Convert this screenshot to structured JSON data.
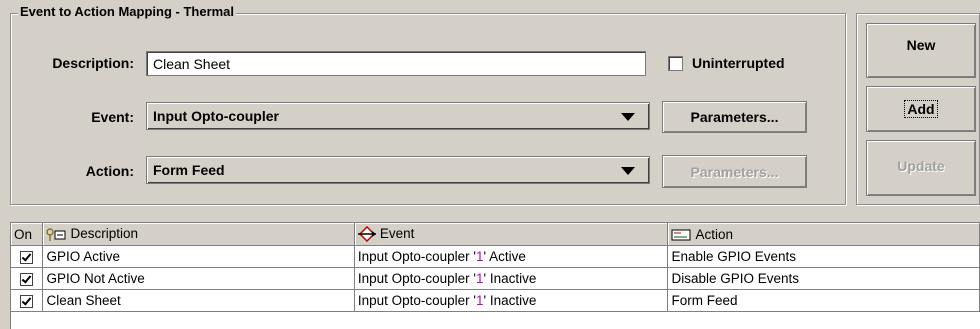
{
  "group": {
    "title": "Event to Action Mapping - Thermal"
  },
  "form": {
    "description_label": "Description:",
    "description_value": "Clean Sheet",
    "uninterrupted_label": "Uninterrupted",
    "event_label": "Event:",
    "event_value": "Input Opto-coupler",
    "event_params_label": "Parameters...",
    "action_label": "Action:",
    "action_value": "Form Feed",
    "action_params_label": "Parameters..."
  },
  "buttons": {
    "new": "New",
    "add": "Add",
    "update": "Update"
  },
  "table": {
    "headers": {
      "on": "On",
      "description": "Description",
      "event": "Event",
      "action": "Action"
    },
    "rows": [
      {
        "on": true,
        "description": "GPIO Active",
        "event_prefix": "Input Opto-coupler '",
        "event_num": "1",
        "event_suffix": "' Active",
        "action": "Enable GPIO Events"
      },
      {
        "on": true,
        "description": "GPIO Not Active",
        "event_prefix": "Input Opto-coupler '",
        "event_num": "1",
        "event_suffix": "' Inactive",
        "action": "Disable GPIO Events"
      },
      {
        "on": true,
        "description": "Clean Sheet",
        "event_prefix": "Input Opto-coupler '",
        "event_num": "1",
        "event_suffix": "' Inactive",
        "action": "Form Feed"
      }
    ]
  },
  "colors": {
    "background": "#d4d0c8",
    "highlight_number": "#c000c0"
  },
  "icons": {
    "description_header": "tag-icon",
    "event_header": "diamond-arrows-icon",
    "action_header": "action-icon"
  }
}
